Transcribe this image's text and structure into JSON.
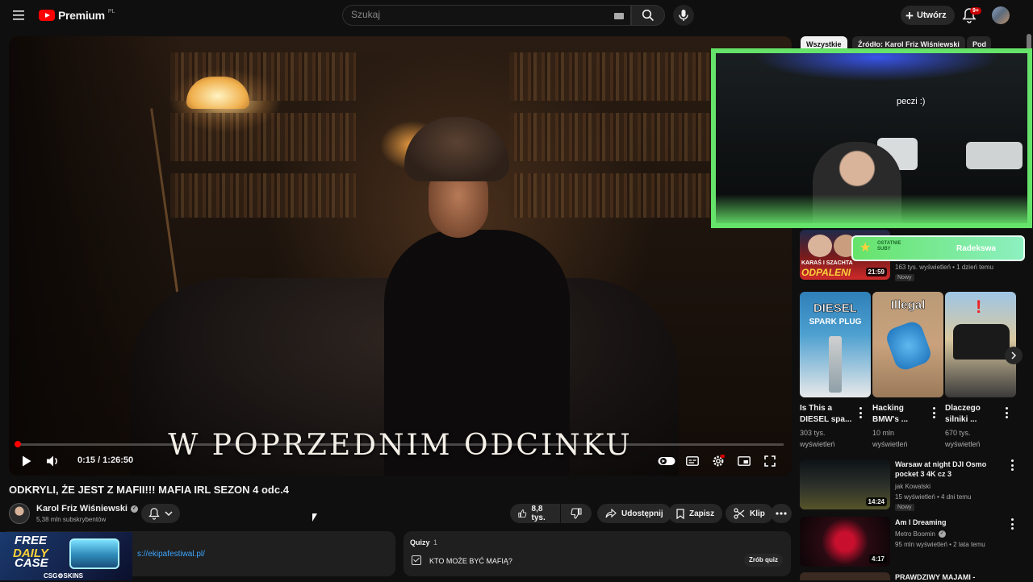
{
  "header": {
    "logo_text": "Premium",
    "country_code": "PL",
    "search_placeholder": "Szukaj",
    "create_label": "Utwórz",
    "notifications_badge": "9+"
  },
  "player": {
    "overlay_subtitle": "W POPRZEDNIM ODCINKU",
    "time_current": "0:15",
    "time_total": "1:26:50",
    "time_display": "0:15 / 1:26:50",
    "progress": 0.0029
  },
  "video": {
    "title": "ODKRYLI, ŻE JEST Z MAFII!!! MAFIA IRL SEZON 4 odc.4",
    "channel_name": "Karol Friz Wiśniewski",
    "subscribers": "5,38 mln subskrybentów",
    "like_count": "8,8 tys.",
    "share_label": "Udostępnij",
    "save_label": "Zapisz",
    "clip_label": "Klip"
  },
  "description": {
    "link": "https://ekipafestiwal.pl/",
    "link_visible": "s://ekipafestiwal.pl/",
    "promo_line1": "FREE",
    "promo_line2": "DAILY",
    "promo_line3": "CASE",
    "promo_brand": "CSG⚙SKINS"
  },
  "quiz": {
    "label": "Quizy",
    "count": "1",
    "question": "KTO MOŻE BYĆ MAFIĄ?",
    "button": "Zrób quiz"
  },
  "sidebar": {
    "chips": [
      "Wszystkie",
      "Źródło: Karol Friz Wiśniewski",
      "Pod"
    ],
    "facecam_text": "peczi :)",
    "sub_badge_label": "OSTATNIE SUBY",
    "sub_badge_name": "Radekswa",
    "first_rec": {
      "thumb_text1": "KARAŚ I SZACHTA",
      "thumb_text2": "ODPALENI",
      "duration": "21:59",
      "meta": "163 tys. wyświetleń • 1 dzień temu",
      "badge": "Nowy"
    },
    "shorts": [
      {
        "thumb_line1": "DIESEL",
        "thumb_line2": "SPARK PLUG",
        "title_line1": "Is This a",
        "title_line2": "DIESEL spa...",
        "views_line1": "303 tys.",
        "views_line2": "wyświetleń"
      },
      {
        "thumb_line1": "Illegal",
        "thumb_line2": "",
        "title_line1": "Hacking",
        "title_line2": "BMW's ...",
        "views_line1": "10 mln",
        "views_line2": "wyświetleń"
      },
      {
        "thumb_line1": "",
        "thumb_line2": "",
        "title_line1": "Dlaczego",
        "title_line2": "silniki ...",
        "views_line1": "670 tys.",
        "views_line2": "wyświetleń"
      }
    ],
    "videos": [
      {
        "title_line1": "Warsaw at night  DJI Osmo",
        "title_line2": "pocket 3 4K cz  3",
        "channel": "jak Kowalski",
        "meta": "15 wyświetleń • 4 dni temu",
        "badge": "Nowy",
        "duration": "14:24"
      },
      {
        "title_line1": "Am I Dreaming",
        "title_line2": "",
        "channel": "Metro Boomin",
        "meta": "95 mln wyświetleń • 2 lata temu",
        "badge": "",
        "duration": "4:17"
      },
      {
        "title_line1": "PRAWDZIWY MAJAMI -",
        "title_line2": "",
        "channel": "",
        "meta": "",
        "badge": "",
        "duration": ""
      }
    ]
  }
}
